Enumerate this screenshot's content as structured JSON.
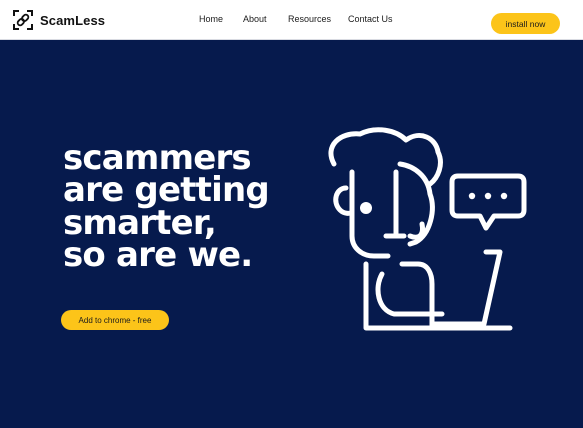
{
  "brand": {
    "name": "ScamLess",
    "icon": "link-icon"
  },
  "nav": {
    "links": [
      "Home",
      "About",
      "Resources",
      "Contact Us"
    ],
    "install_label": "install now"
  },
  "hero": {
    "headline_lines": [
      "scammers",
      "are getting",
      "smarter,",
      "so are we."
    ],
    "cta_label": "Add to chrome - free",
    "illustration": "person-at-laptop-with-chat-bubble-icon"
  },
  "colors": {
    "background": "#061a4d",
    "accent": "#fcc419",
    "navbar": "#ffffff"
  }
}
